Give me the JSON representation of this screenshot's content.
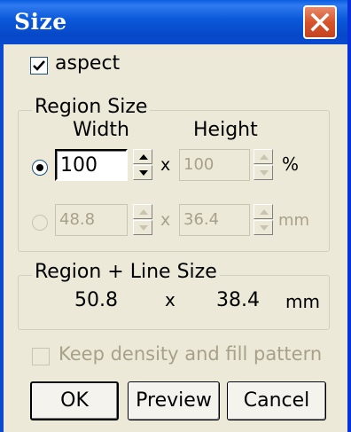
{
  "window": {
    "title": "Size",
    "close_icon": "close-icon"
  },
  "aspect": {
    "label": "aspect",
    "checked": true
  },
  "region_size": {
    "legend": "Region Size",
    "width_header": "Width",
    "height_header": "Height",
    "percent_row": {
      "width": "100",
      "x": "x",
      "height": "100",
      "unit": "%",
      "selected": true
    },
    "mm_row": {
      "width": "48.8",
      "x": "x",
      "height": "36.4",
      "unit": "mm",
      "selected": false
    }
  },
  "region_line_size": {
    "legend": "Region + Line Size",
    "width": "50.8",
    "x": "x",
    "height": "38.4",
    "unit": "mm"
  },
  "keep_density": {
    "label": "Keep density and fill pattern",
    "checked": false,
    "enabled": false
  },
  "buttons": {
    "ok": "OK",
    "preview": "Preview",
    "cancel": "Cancel"
  }
}
